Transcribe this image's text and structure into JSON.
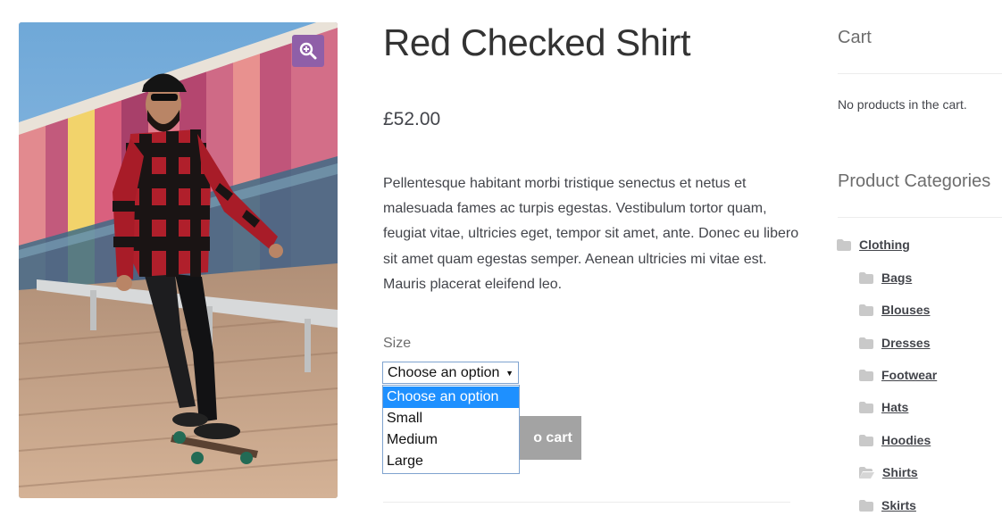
{
  "product": {
    "title": "Red Checked Shirt",
    "price": "£52.00",
    "description": "Pellentesque habitant morbi tristique senectus et netus et malesuada fames ac turpis egestas. Vestibulum tortor quam, feugiat vitae, ultricies eget, tempor sit amet, ante. Donec eu libero sit amet quam egestas semper. Aenean ultricies mi vitae est. Mauris placerat eleifend leo.",
    "zoom_icon": "magnifier-plus-icon",
    "accent_color": "#8f5fa8"
  },
  "variation": {
    "label": "Size",
    "selected": "Choose an option",
    "options": [
      "Choose an option",
      "Small",
      "Medium",
      "Large"
    ],
    "highlight_color": "#1e90ff"
  },
  "add_to_cart": {
    "label": "Add to cart",
    "visible_fragment": "o cart"
  },
  "sidebar": {
    "cart": {
      "title": "Cart",
      "empty_text": "No products in the cart."
    },
    "categories": {
      "title": "Product Categories",
      "items": [
        {
          "label": "Clothing",
          "icon": "folder-icon"
        },
        {
          "label": "Bags",
          "icon": "folder-icon"
        },
        {
          "label": "Blouses",
          "icon": "folder-icon"
        },
        {
          "label": "Dresses",
          "icon": "folder-icon"
        },
        {
          "label": "Footwear",
          "icon": "folder-icon"
        },
        {
          "label": "Hats",
          "icon": "folder-icon"
        },
        {
          "label": "Hoodies",
          "icon": "folder-icon"
        },
        {
          "label": "Shirts",
          "icon": "folder-open-icon"
        },
        {
          "label": "Skirts",
          "icon": "folder-icon"
        }
      ]
    }
  }
}
